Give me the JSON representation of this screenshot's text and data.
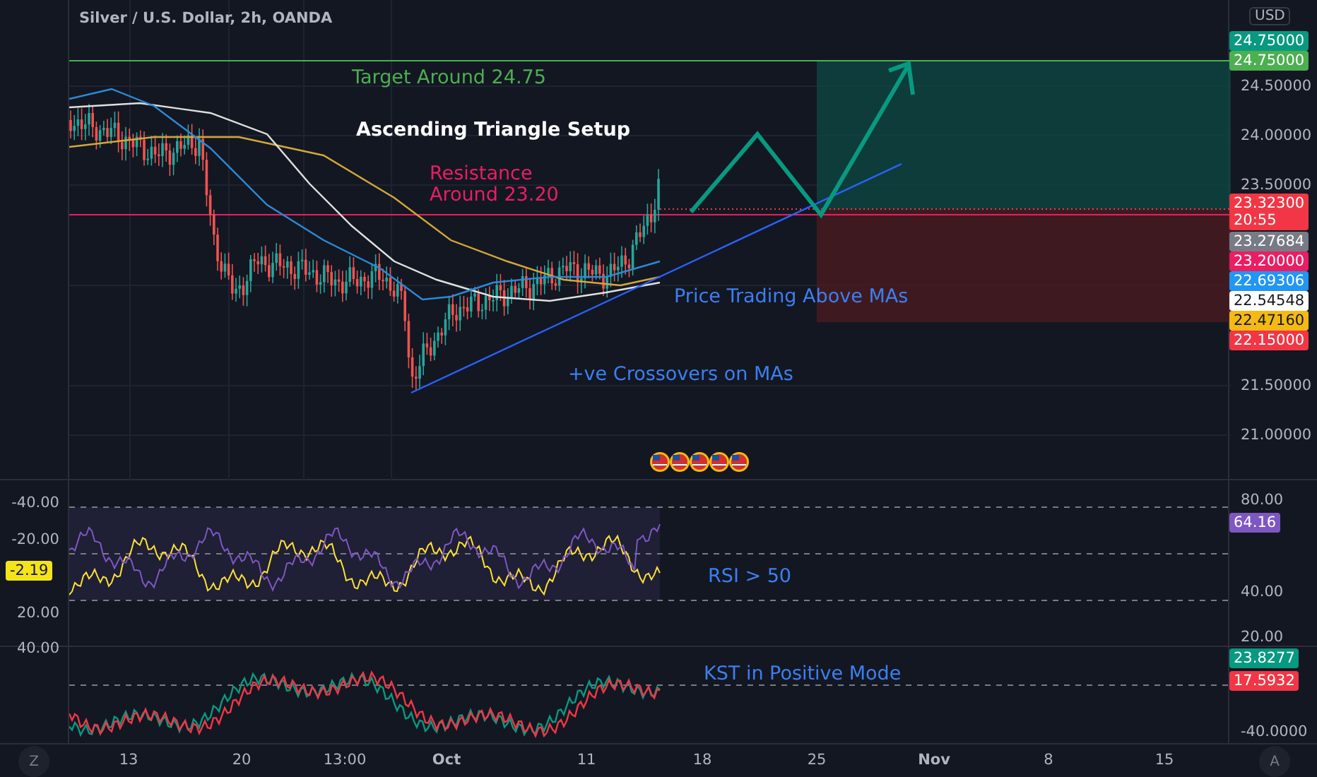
{
  "header": {
    "title": "Silver / U.S. Dollar, 2h, OANDA"
  },
  "main_pane": {
    "annotations": [
      {
        "text": "Target Around 24.75",
        "color": "#4caf50"
      },
      {
        "text": "Ascending Triangle Setup",
        "color": "#ffffff"
      },
      {
        "text": "Resistance Around 23.20",
        "color": "#e91e63"
      },
      {
        "text": "Price Trading Above MAs",
        "color": "#3d7ff0"
      },
      {
        "text": "+ve Crossovers on MAs",
        "color": "#3d7ff0"
      }
    ]
  },
  "price_axis": {
    "currency": "USD",
    "ticks": [
      "24.50000",
      "24.00000",
      "23.50000",
      "21.50000",
      "21.00000"
    ],
    "badges": [
      {
        "text": "24.75000",
        "color": "#089981"
      },
      {
        "text": "24.75000",
        "color": "#4caf50"
      },
      {
        "text": "23.32300",
        "sub": "20:55",
        "color": "#f23645"
      },
      {
        "text": "23.27684",
        "color": "#787b86"
      },
      {
        "text": "23.20000",
        "color": "#e91e63"
      },
      {
        "text": "22.69306",
        "color": "#2196f3"
      },
      {
        "text": "22.54548",
        "color": "#ffffff"
      },
      {
        "text": "22.47160",
        "color": "#f5b914"
      },
      {
        "text": "22.15000",
        "color": "#f23645"
      }
    ]
  },
  "rsi_pane": {
    "label": "RSI > 50",
    "left_ticks": [
      "-40.00",
      "-20.00",
      "20.00",
      "40.00"
    ],
    "left_badge": {
      "text": "-2.19",
      "color": "#f5e31a"
    },
    "right_ticks": [
      "80.00",
      "40.00",
      "20.00"
    ],
    "right_badge": {
      "text": "64.16",
      "color": "#7e57c2"
    }
  },
  "kst_pane": {
    "label": "KST in Positive Mode",
    "badges": [
      {
        "text": "23.8277",
        "color": "#089981"
      },
      {
        "text": "17.5932",
        "color": "#f23645"
      }
    ],
    "ticks": [
      "-40.0000"
    ]
  },
  "time_axis": {
    "left_button": "Z",
    "labels": [
      "13",
      "20",
      "13:00",
      "Oct",
      "11",
      "18",
      "25",
      "Nov",
      "8",
      "15"
    ],
    "right_button": "A"
  }
}
